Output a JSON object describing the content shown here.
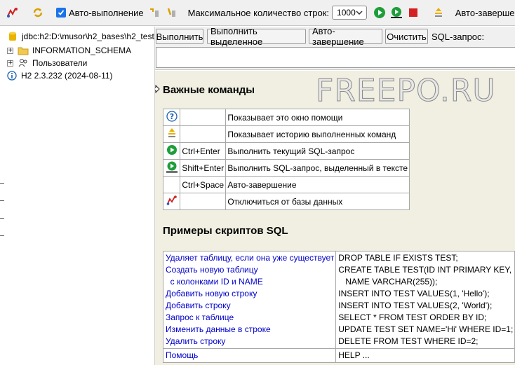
{
  "toolbar": {
    "autocomplete_label": "Авто-выполнение",
    "max_rows_label": "Максимальное количество строк:",
    "max_rows_value": "1000",
    "autocomplete2_label": "Авто-завершение"
  },
  "tree": {
    "connection": "jdbc:h2:D:\\musor\\h2_bases\\h2_test",
    "items": [
      {
        "label": "INFORMATION_SCHEMA"
      },
      {
        "label": "Пользователи"
      }
    ],
    "version": "H2 2.3.232 (2024-08-11)"
  },
  "query_bar": {
    "run_label": "Выполнить",
    "run_selected_label": "Выполнить выделенное",
    "autocomplete_label": "Авто-завершение",
    "clear_label": "Очистить",
    "sql_label": "SQL-запрос:"
  },
  "help": {
    "watermark": "FREEPO.RU",
    "important_title": "Важные команды",
    "commands": [
      {
        "icon": "help-icon",
        "key": "",
        "desc": "Показывает это окно помощи"
      },
      {
        "icon": "history-icon",
        "key": "",
        "desc": "Показывает историю выполненных команд"
      },
      {
        "icon": "run-icon",
        "key": "Ctrl+Enter",
        "desc": "Выполнить текущий SQL-запрос"
      },
      {
        "icon": "run-selected-icon",
        "key": "Shift+Enter",
        "desc": "Выполнить SQL-запрос, выделенный в тексте"
      },
      {
        "icon": "",
        "key": "Ctrl+Space",
        "desc": "Авто-завершение"
      },
      {
        "icon": "disconnect-icon",
        "key": "",
        "desc": "Отключиться от базы данных"
      }
    ],
    "examples_title": "Примеры скриптов SQL",
    "examples": [
      "Удаляет таблицу, если она уже существует",
      "Создать новую таблицу",
      "  с колонками ID и NAME",
      "Добавить новую строку",
      "Добавить строку",
      "Запрос к таблице",
      "Изменить данные в строке",
      "Удалить строку"
    ],
    "sql": [
      "DROP TABLE IF EXISTS TEST;",
      "CREATE TABLE TEST(ID INT PRIMARY KEY,",
      "   NAME VARCHAR(255));",
      "INSERT INTO TEST VALUES(1, 'Hello');",
      "INSERT INTO TEST VALUES(2, 'World');",
      "SELECT * FROM TEST ORDER BY ID;",
      "UPDATE TEST SET NAME='Hi' WHERE ID=1;",
      "DELETE FROM TEST WHERE ID=2;"
    ],
    "help_link": "Помощь",
    "help_sql": "HELP ..."
  },
  "colors": {
    "accent": "#1a73e8",
    "run_green": "#1e9e3a",
    "stop_red": "#d42020",
    "link": "#0000cc",
    "help_bg": "#f0efe1"
  }
}
